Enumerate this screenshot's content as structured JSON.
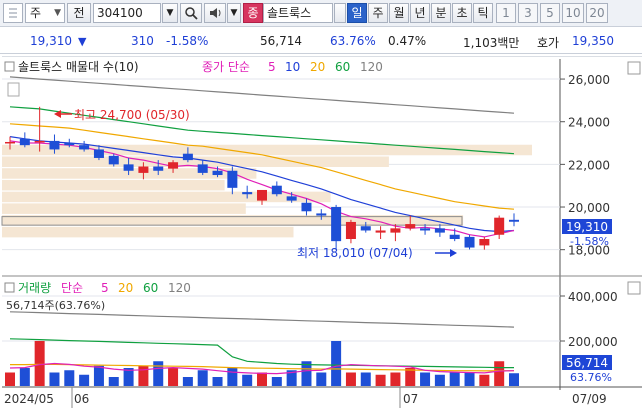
{
  "toolbar": {
    "market_label": "주",
    "continuous_label": "전",
    "code_value": "304100",
    "name_value": "솔트룩스",
    "badge_label": "종",
    "period_tabs": [
      {
        "label": "일",
        "active": true
      },
      {
        "label": "주",
        "active": false
      },
      {
        "label": "월",
        "active": false
      },
      {
        "label": "년",
        "active": false
      },
      {
        "label": "분",
        "active": false
      },
      {
        "label": "초",
        "active": false
      },
      {
        "label": "틱",
        "active": false
      }
    ],
    "interval_buttons": [
      "1",
      "3",
      "5",
      "10",
      "20"
    ],
    "icons": [
      "dropdown-icon",
      "search-icon",
      "speaker-icon",
      "chevron-down-icon"
    ]
  },
  "quote": {
    "price": "19,310",
    "direction_icon": "down-triangle-icon",
    "direction_symbol": "▼",
    "change": "310",
    "change_pct": "-1.58%",
    "volume": "56,714",
    "ratio_pct": "63.76%",
    "turnover_pct": "0.47%",
    "amount": "1,103백만",
    "ask_label": "호가",
    "ask_price": "19,350"
  },
  "price_panel": {
    "legend_title": "솔트룩스 매물대 수(10)",
    "legend_ma_prefix": "종가 단순",
    "ma_periods": [
      {
        "label": "5",
        "color": "#e020b8"
      },
      {
        "label": "10",
        "color": "#2040d8"
      },
      {
        "label": "20",
        "color": "#f0a800"
      },
      {
        "label": "60",
        "color": "#10a040"
      },
      {
        "label": "120",
        "color": "#808080"
      }
    ],
    "high_annotation": "최고 24,700 (05/30)",
    "low_annotation": "최저 18,010 (07/04)",
    "current_price_tag": "19,310",
    "current_change_tag": "-1.58%",
    "y_ticks": [
      "26,000",
      "24,000",
      "22,000",
      "20,000",
      "18,000"
    ]
  },
  "volume_panel": {
    "legend_title": "거래량",
    "legend_ma_prefix": "단순",
    "ma_periods": [
      {
        "label": "5",
        "color": "#e020b8"
      },
      {
        "label": "20",
        "color": "#f0a800"
      },
      {
        "label": "60",
        "color": "#10a040"
      },
      {
        "label": "120",
        "color": "#808080"
      }
    ],
    "volume_label": "56,714주(63.76%)",
    "current_volume_tag": "56,714",
    "current_pct_tag": "63.76%",
    "y_ticks": [
      "400,000",
      "200,000"
    ]
  },
  "x_axis": {
    "labels": [
      "2024/05",
      "06",
      "07",
      "07/09"
    ]
  },
  "colors": {
    "up": "#e0262b",
    "down": "#1e4fd6",
    "ma5": "#e020b8",
    "ma10": "#2040d8",
    "ma20": "#f0a800",
    "ma60": "#10a040",
    "ma120": "#808080",
    "volume_profile": "#f5e6d3"
  },
  "chart_data": {
    "type": "candlestick",
    "x_range": [
      "2024/05",
      "07/09"
    ],
    "ylim": [
      17000,
      26800
    ],
    "y_ticks": [
      18000,
      20000,
      22000,
      24000,
      26000
    ],
    "high": {
      "value": 24700,
      "date": "05/30"
    },
    "low": {
      "value": 18010,
      "date": "07/04"
    },
    "last_close": 19310,
    "candles": [
      {
        "o": 23000,
        "h": 23300,
        "l": 22700,
        "c": 23050
      },
      {
        "o": 23200,
        "h": 23500,
        "l": 22800,
        "c": 22900
      },
      {
        "o": 23100,
        "h": 24700,
        "l": 22600,
        "c": 23100
      },
      {
        "o": 23100,
        "h": 23400,
        "l": 22500,
        "c": 22700
      },
      {
        "o": 23000,
        "h": 23200,
        "l": 22800,
        "c": 22900
      },
      {
        "o": 22900,
        "h": 23100,
        "l": 22600,
        "c": 22700
      },
      {
        "o": 22700,
        "h": 22900,
        "l": 22200,
        "c": 22300
      },
      {
        "o": 22400,
        "h": 22500,
        "l": 21900,
        "c": 22000
      },
      {
        "o": 22000,
        "h": 22300,
        "l": 21500,
        "c": 21700
      },
      {
        "o": 21600,
        "h": 22100,
        "l": 21300,
        "c": 21900
      },
      {
        "o": 21900,
        "h": 22200,
        "l": 21500,
        "c": 21700
      },
      {
        "o": 21800,
        "h": 22200,
        "l": 21600,
        "c": 22100
      },
      {
        "o": 22500,
        "h": 22800,
        "l": 22100,
        "c": 22200
      },
      {
        "o": 22000,
        "h": 22200,
        "l": 21500,
        "c": 21600
      },
      {
        "o": 21700,
        "h": 21900,
        "l": 21400,
        "c": 21500
      },
      {
        "o": 21700,
        "h": 21900,
        "l": 20600,
        "c": 20900
      },
      {
        "o": 20700,
        "h": 21000,
        "l": 20400,
        "c": 20600
      },
      {
        "o": 20300,
        "h": 20800,
        "l": 20100,
        "c": 20800
      },
      {
        "o": 21000,
        "h": 21200,
        "l": 20500,
        "c": 20600
      },
      {
        "o": 20500,
        "h": 20700,
        "l": 20200,
        "c": 20300
      },
      {
        "o": 20200,
        "h": 20400,
        "l": 19600,
        "c": 19800
      },
      {
        "o": 19700,
        "h": 19900,
        "l": 19400,
        "c": 19600
      },
      {
        "o": 20000,
        "h": 20100,
        "l": 18000,
        "c": 18400
      },
      {
        "o": 18500,
        "h": 19400,
        "l": 18300,
        "c": 19300
      },
      {
        "o": 19100,
        "h": 19300,
        "l": 18800,
        "c": 18900
      },
      {
        "o": 18800,
        "h": 19100,
        "l": 18500,
        "c": 18900
      },
      {
        "o": 18800,
        "h": 19200,
        "l": 18400,
        "c": 19000
      },
      {
        "o": 19000,
        "h": 19600,
        "l": 18900,
        "c": 19200
      },
      {
        "o": 19000,
        "h": 19200,
        "l": 18700,
        "c": 18900
      },
      {
        "o": 19000,
        "h": 19200,
        "l": 18600,
        "c": 18800
      },
      {
        "o": 18700,
        "h": 19000,
        "l": 18400,
        "c": 18500
      },
      {
        "o": 18600,
        "h": 18700,
        "l": 18010,
        "c": 18100
      },
      {
        "o": 18200,
        "h": 18600,
        "l": 18000,
        "c": 18500
      },
      {
        "o": 18700,
        "h": 19600,
        "l": 18500,
        "c": 19500
      },
      {
        "o": 19400,
        "h": 19700,
        "l": 19100,
        "c": 19310
      }
    ],
    "ma_lines": {
      "ma5": [
        23100,
        23000,
        23000,
        22950,
        22900,
        22800,
        22650,
        22500,
        22300,
        22200,
        22050,
        21900,
        21950,
        21900,
        21800,
        21600,
        21300,
        21050,
        20800,
        20600,
        20400,
        20150,
        19800,
        19550,
        19450,
        19300,
        19100,
        19000,
        19050,
        18980,
        18900,
        18700,
        18600,
        18750,
        18900
      ],
      "ma10": [
        23300,
        23200,
        23100,
        23050,
        23000,
        22950,
        22850,
        22750,
        22650,
        22550,
        22450,
        22350,
        22300,
        22200,
        22100,
        21950,
        21800,
        21650,
        21450,
        21250,
        21050,
        20850,
        20600,
        20350,
        20150,
        19950,
        19750,
        19600,
        19450,
        19300,
        19150,
        19000,
        18900,
        18850,
        18900
      ],
      "ma20": [
        23900,
        23850,
        23800,
        23750,
        23700,
        23600,
        23500,
        23400,
        23300,
        23200,
        23100,
        23000,
        22900,
        22850,
        22750,
        22650,
        22550,
        22450,
        22300,
        22150,
        22000,
        21850,
        21650,
        21450,
        21250,
        21050,
        20850,
        20700,
        20550,
        20400,
        20250,
        20150,
        20050,
        19950,
        19900
      ],
      "ma60": [
        24700,
        24650,
        24600,
        24500,
        24400,
        24300,
        24200,
        24100,
        24000,
        23900,
        23800,
        23700,
        23600,
        23550,
        23500,
        23450,
        23400,
        23350,
        23300,
        23250,
        23200,
        23150,
        23100,
        23050,
        23000,
        22950,
        22900,
        22850,
        22800,
        22750,
        22700,
        22650,
        22600,
        22550,
        22500
      ],
      "ma120": [
        26100,
        26050,
        26000,
        25950,
        25900,
        25850,
        25800,
        25750,
        25700,
        25650,
        25600,
        25550,
        25500,
        25450,
        25400,
        25350,
        25300,
        25250,
        25200,
        25150,
        25100,
        25050,
        25000,
        24950,
        24900,
        24850,
        24800,
        24750,
        24700,
        24650,
        24600,
        24550,
        24500,
        24450,
        24400
      ]
    },
    "volume_profile": [
      {
        "price": 22650,
        "weight": 1.0
      },
      {
        "price": 22100,
        "weight": 0.73
      },
      {
        "price": 21550,
        "weight": 0.48
      },
      {
        "price": 21000,
        "weight": 0.42
      },
      {
        "price": 20450,
        "weight": 0.62
      },
      {
        "price": 19900,
        "weight": 0.46
      },
      {
        "price": 19350,
        "weight": 0.87
      },
      {
        "price": 18800,
        "weight": 0.55
      }
    ],
    "volume": {
      "ylim": [
        0,
        480000
      ],
      "y_ticks": [
        200000,
        400000
      ],
      "values": [
        60000,
        80000,
        200000,
        60000,
        70000,
        50000,
        90000,
        40000,
        80000,
        90000,
        110000,
        80000,
        40000,
        70000,
        40000,
        80000,
        50000,
        60000,
        40000,
        70000,
        110000,
        60000,
        200000,
        60000,
        60000,
        50000,
        60000,
        80000,
        60000,
        50000,
        60000,
        60000,
        50000,
        110000,
        56714
      ],
      "ma5": [
        80000,
        82000,
        95000,
        100000,
        96000,
        88000,
        84000,
        75000,
        70000,
        72000,
        78000,
        82000,
        78000,
        75000,
        68000,
        62000,
        58000,
        56000,
        55000,
        60000,
        68000,
        70000,
        88000,
        95000,
        92000,
        90000,
        88000,
        85000,
        70000,
        64000,
        62000,
        60000,
        58000,
        66000,
        68000
      ],
      "ma20": [
        95000,
        95000,
        96000,
        96000,
        95000,
        94000,
        93000,
        92000,
        91000,
        90000,
        89000,
        88000,
        87000,
        86000,
        84000,
        82000,
        80000,
        79000,
        78000,
        77000,
        76000,
        75000,
        76000,
        75000,
        74000,
        73000,
        72000,
        71000,
        70000,
        69000,
        68000,
        68000,
        67000,
        68000,
        68000
      ],
      "ma60": [
        210000,
        208000,
        206000,
        204000,
        202000,
        200000,
        198000,
        196000,
        194000,
        192000,
        190000,
        188000,
        186000,
        184000,
        182000,
        130000,
        110000,
        105000,
        100000,
        97000,
        95000,
        94000,
        93000,
        92000,
        91000,
        90000,
        89000,
        88000,
        87000,
        86000,
        85000,
        84000,
        83000,
        82000,
        82000
      ],
      "ma120": [
        330000,
        328000,
        326000,
        324000,
        322000,
        320000,
        318000,
        316000,
        314000,
        312000,
        310000,
        308000,
        306000,
        304000,
        302000,
        300000,
        298000,
        296000,
        294000,
        292000,
        290000,
        288000,
        286000,
        284000,
        282000,
        280000,
        278000,
        276000,
        274000,
        272000,
        270000,
        268000,
        266000,
        264000,
        262000
      ]
    }
  }
}
